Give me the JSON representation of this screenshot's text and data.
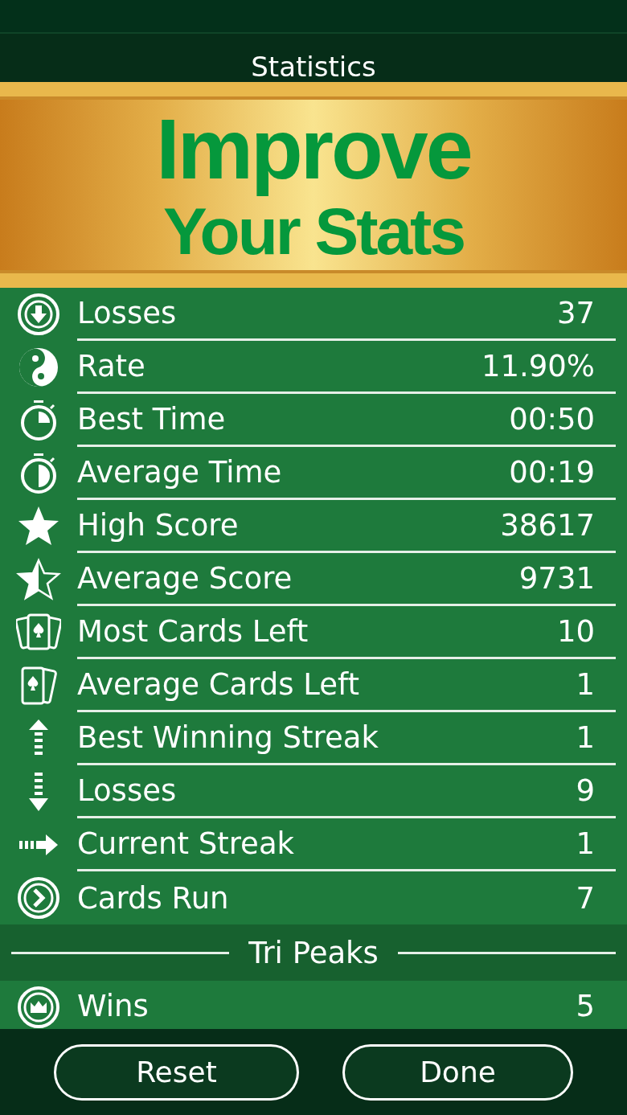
{
  "header": {
    "title": "Statistics"
  },
  "banner": {
    "line1": "Improve",
    "line2": "Your Stats"
  },
  "sections": [
    {
      "rows": [
        {
          "label": "Losses",
          "value": "37"
        },
        {
          "label": "Rate",
          "value": "11.90%"
        },
        {
          "label": "Best Time",
          "value": "00:50"
        },
        {
          "label": "Average Time",
          "value": "00:19"
        },
        {
          "label": "High Score",
          "value": "38617"
        },
        {
          "label": "Average Score",
          "value": "9731"
        },
        {
          "label": "Most Cards Left",
          "value": "10"
        },
        {
          "label": "Average Cards Left",
          "value": "1"
        },
        {
          "label": "Best Winning Streak",
          "value": "1"
        },
        {
          "label": "Losses",
          "value": "9"
        },
        {
          "label": "Current Streak",
          "value": "1"
        },
        {
          "label": "Cards Run",
          "value": "7"
        }
      ]
    },
    {
      "title": "Tri Peaks",
      "rows": [
        {
          "label": "Wins",
          "value": "5"
        }
      ]
    }
  ],
  "buttons": [
    "Reset",
    "Done"
  ]
}
